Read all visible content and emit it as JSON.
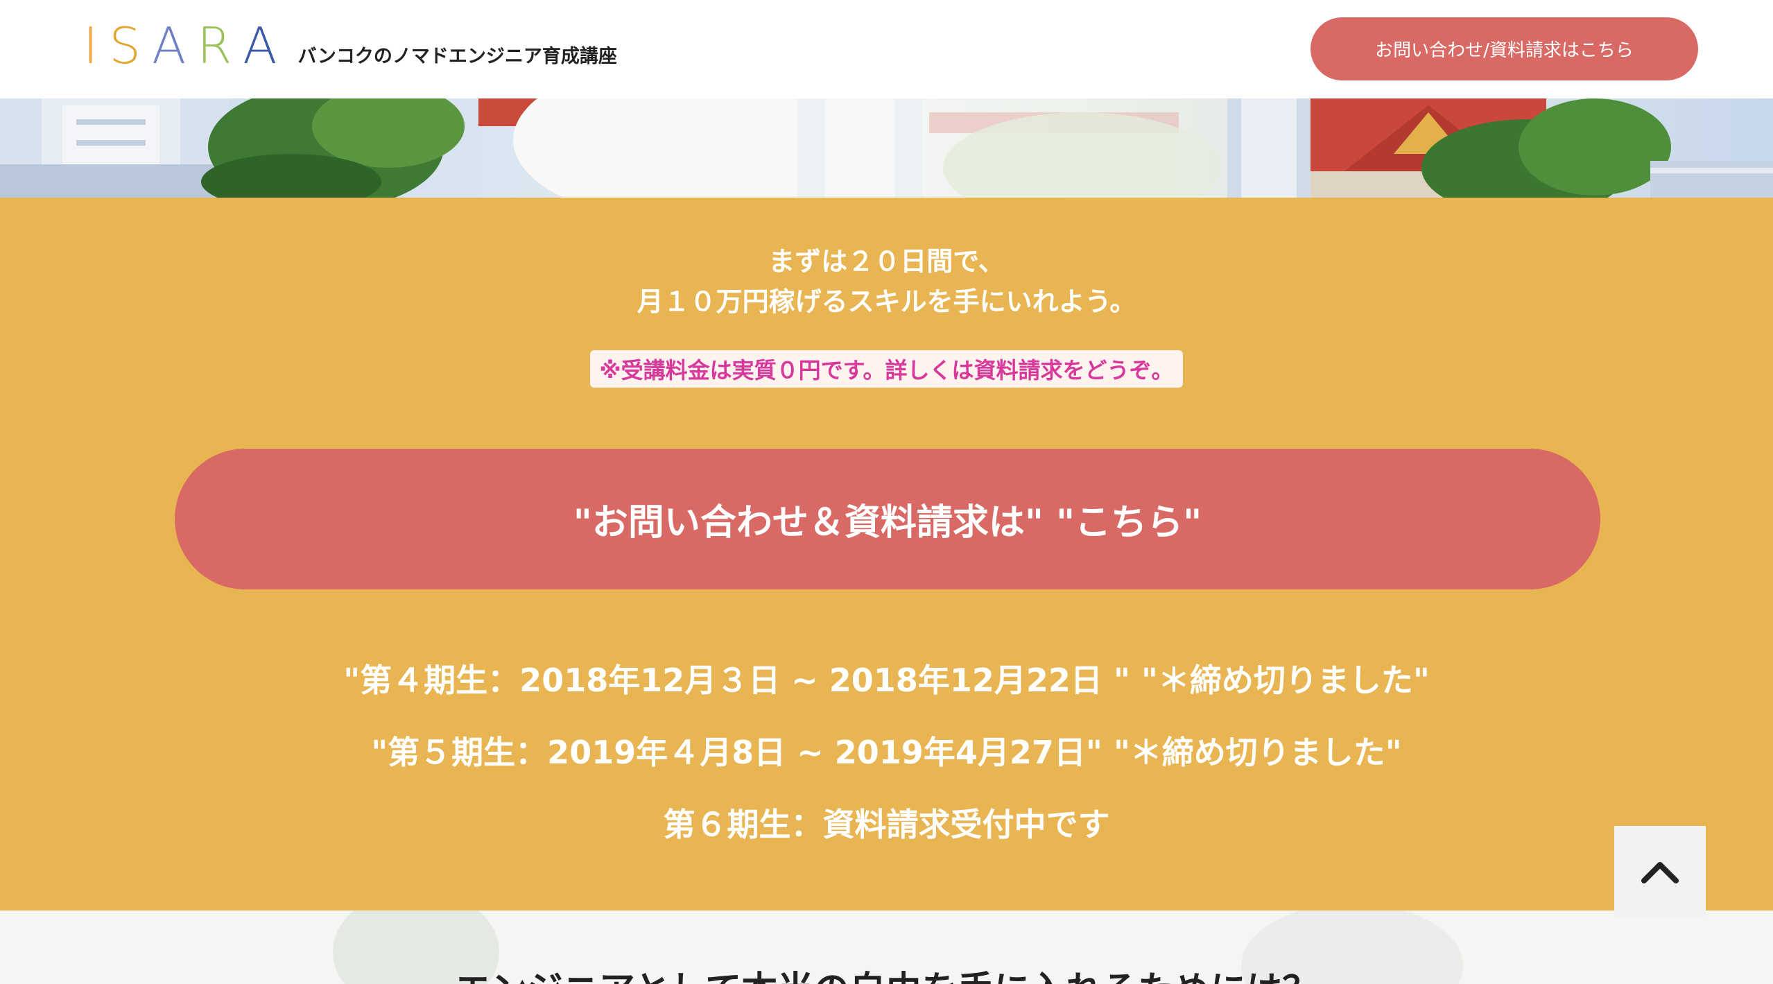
{
  "header": {
    "logo_letters": [
      "I",
      "S",
      "A",
      "R",
      "A"
    ],
    "logo_colors": [
      "#f2a33a",
      "#e5a531",
      "#6f7fc4",
      "#9bc25a",
      "#3a5aa8"
    ],
    "tagline": "バンコクのノマドエンジニア育成講座",
    "cta_label": "お問い合わせ/資料請求はこちら"
  },
  "band": {
    "lead_line1": "まずは２０日間で、",
    "lead_line2": "月１０万円稼げるスキルを手にいれよう。",
    "note": "※受講料金は実質０円です。詳しくは資料請求をどうぞ。",
    "cta_label": "\"お問い合わせ＆資料請求は\" \"こちら\"",
    "terms": [
      "\"第４期生：2018年12月３日 ~ 2018年12月22日 \" \"＊締め切りました\"",
      "\"第５期生：2019年４月8日 ~ 2019年4月27日\" \"＊締め切りました\"",
      "第６期生：資料請求受付中です"
    ]
  },
  "next_section": {
    "title": "エンジニアとして本当の自由を手に入れるためには？"
  },
  "colors": {
    "band": "#e8b552",
    "cta": "#d96964",
    "note_text": "#d6399b"
  },
  "icons": {
    "scroll_top": "chevron-up-icon"
  }
}
